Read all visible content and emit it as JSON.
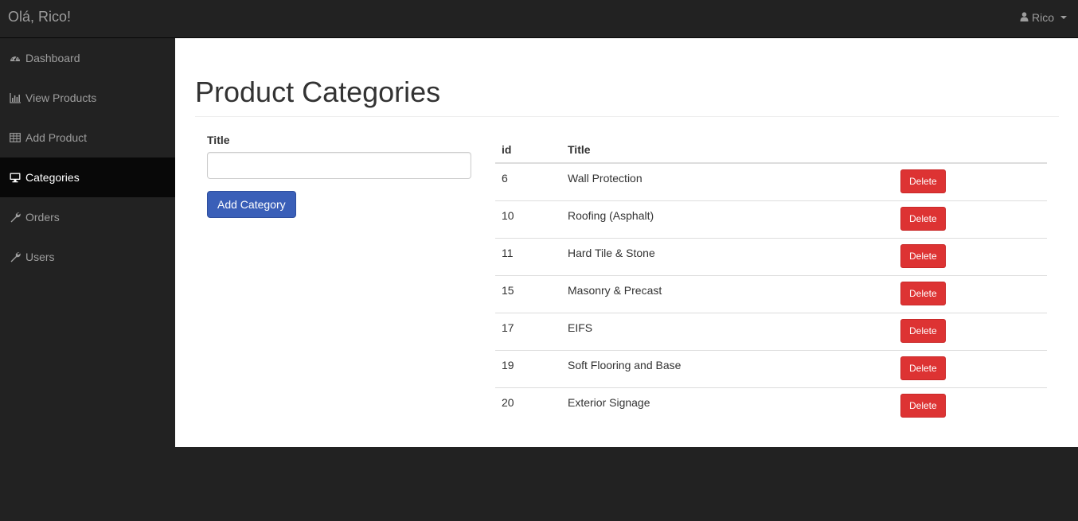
{
  "navbar": {
    "brand": "Olá, Rico!",
    "user_name": "Rico"
  },
  "sidebar": {
    "items": [
      {
        "label": "Dashboard",
        "icon": "dashboard-icon"
      },
      {
        "label": "View Products",
        "icon": "bar-chart-icon"
      },
      {
        "label": "Add Product",
        "icon": "table-icon"
      },
      {
        "label": "Categories",
        "icon": "desktop-icon",
        "active": true
      },
      {
        "label": "Orders",
        "icon": "wrench-icon"
      },
      {
        "label": "Users",
        "icon": "wrench-icon"
      }
    ]
  },
  "main": {
    "page_title": "Product Categories",
    "form": {
      "title_label": "Title",
      "title_value": "",
      "title_placeholder": "",
      "submit_label": "Add Category"
    },
    "table": {
      "headers": {
        "id": "id",
        "title": "Title"
      },
      "delete_label": "Delete",
      "rows": [
        {
          "id": "6",
          "title": "Wall Protection"
        },
        {
          "id": "10",
          "title": "Roofing (Asphalt)"
        },
        {
          "id": "11",
          "title": "Hard Tile & Stone"
        },
        {
          "id": "15",
          "title": "Masonry & Precast"
        },
        {
          "id": "17",
          "title": "EIFS"
        },
        {
          "id": "19",
          "title": "Soft Flooring and Base"
        },
        {
          "id": "20",
          "title": "Exterior Signage"
        }
      ]
    }
  },
  "colors": {
    "navbar_bg": "#222222",
    "sidebar_active_bg": "#080808",
    "primary_button": "#3a5fb8",
    "danger_button": "#dd3333"
  }
}
